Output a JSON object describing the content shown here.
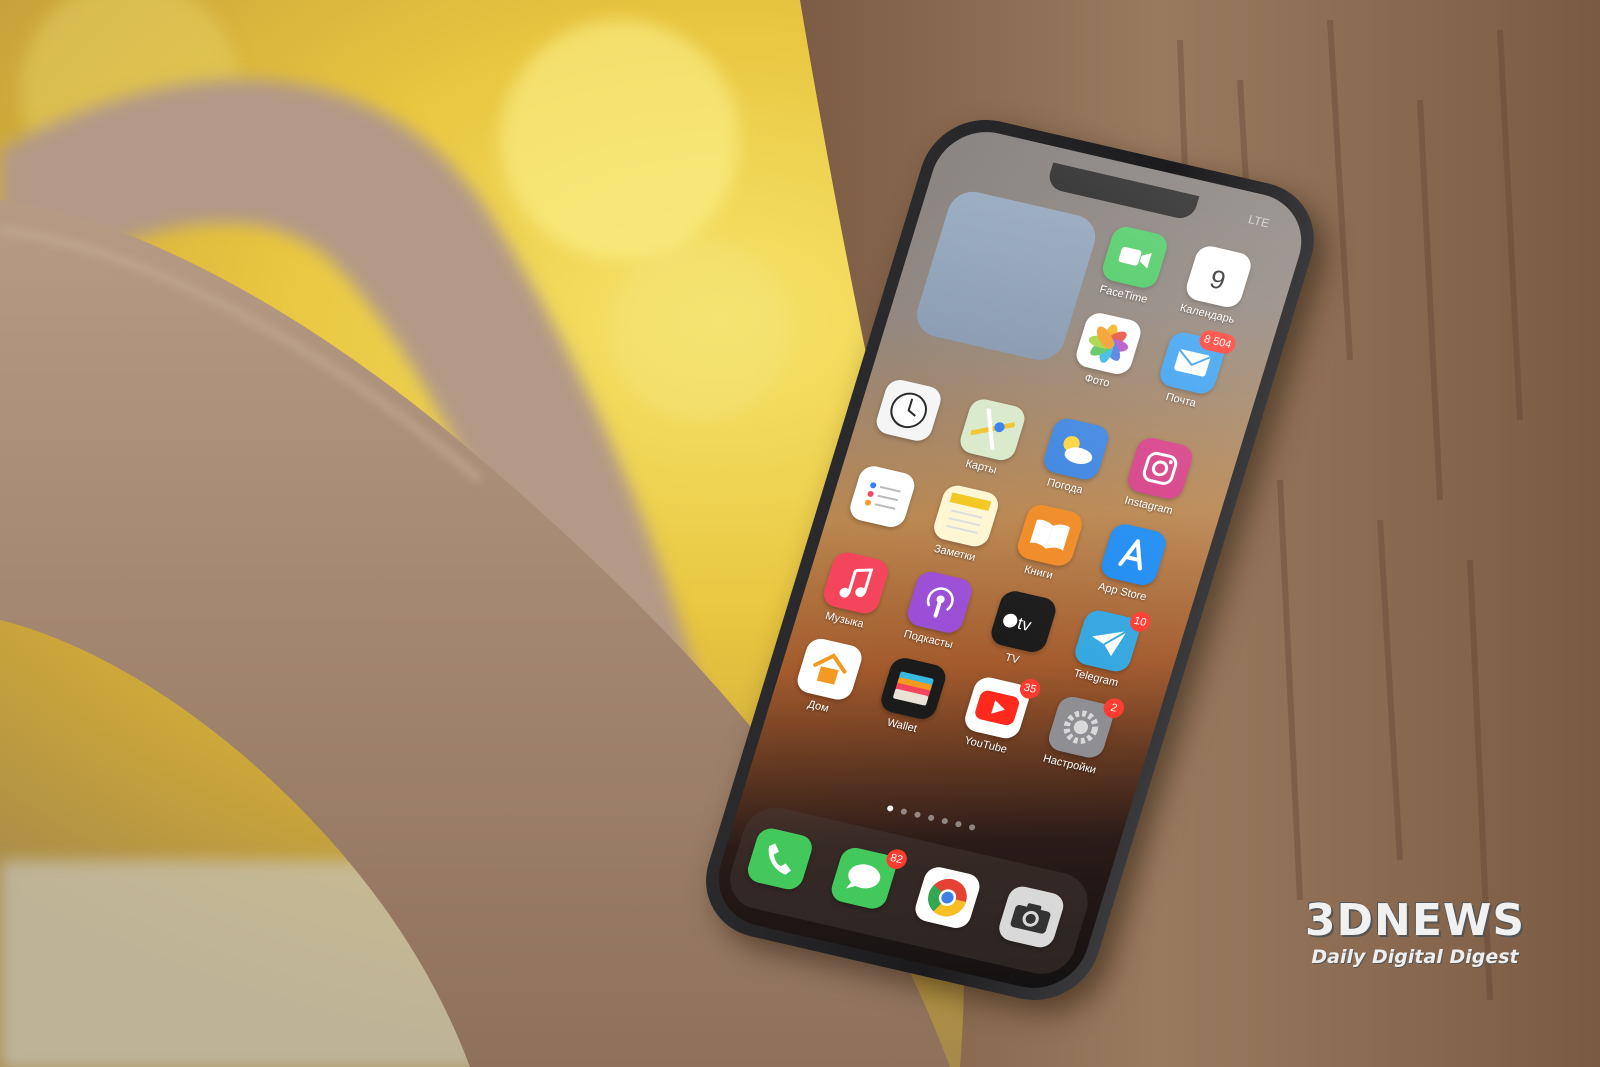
{
  "scene": {
    "description_colors": {
      "foliage": "#e7c94a",
      "bark": "#a0836a",
      "trunk": "#8d6b50",
      "phone_frame": "#1e1e20"
    }
  },
  "phone": {
    "status": {
      "time": "",
      "carrier": "LTE"
    },
    "widget": {
      "label": ""
    },
    "apps": [
      {
        "id": "facetime",
        "label": "FaceTime",
        "icon": "video-camera",
        "color": "#43c85c",
        "badge": ""
      },
      {
        "id": "calendar",
        "label": "Календарь",
        "icon": "calendar-day",
        "color": "#ffffff",
        "badge": "",
        "day": "9"
      },
      {
        "id": "photos",
        "label": "Фото",
        "icon": "photos-flower",
        "color": "#ffffff",
        "badge": ""
      },
      {
        "id": "mail",
        "label": "Почта",
        "icon": "envelope",
        "color": "#3aa0f0",
        "badge": "8 504"
      },
      {
        "id": "clock",
        "label": "",
        "icon": "clock",
        "color": "#f5f5f5",
        "badge": ""
      },
      {
        "id": "maps",
        "label": "Карты",
        "icon": "map",
        "color": "#d8e9c9",
        "badge": ""
      },
      {
        "id": "weather",
        "label": "Погода",
        "icon": "weather-cloud-sun",
        "color": "#3b84e0",
        "badge": ""
      },
      {
        "id": "instagram",
        "label": "Instagram",
        "icon": "instagram-camera",
        "color": "#d63e86",
        "badge": ""
      },
      {
        "id": "reminders",
        "label": "",
        "icon": "list",
        "color": "#ffffff",
        "badge": ""
      },
      {
        "id": "notes",
        "label": "Заметки",
        "icon": "notepad",
        "color": "#fff6d3",
        "badge": ""
      },
      {
        "id": "books",
        "label": "Книги",
        "icon": "open-book",
        "color": "#f08a24",
        "badge": ""
      },
      {
        "id": "appstore",
        "label": "App Store",
        "icon": "app-store-a",
        "color": "#1e8cf2",
        "badge": ""
      },
      {
        "id": "music",
        "label": "Музыка",
        "icon": "music-note",
        "color": "#f5455c",
        "badge": ""
      },
      {
        "id": "podcasts",
        "label": "Подкасты",
        "icon": "podcast",
        "color": "#9b4fd6",
        "badge": ""
      },
      {
        "id": "tv",
        "label": "TV",
        "icon": "apple-tv",
        "color": "#1a1a1a",
        "badge": ""
      },
      {
        "id": "telegram",
        "label": "Telegram",
        "icon": "paper-plane",
        "color": "#34a6e0",
        "badge": "10"
      },
      {
        "id": "home",
        "label": "Дом",
        "icon": "house",
        "color": "#ffffff",
        "badge": ""
      },
      {
        "id": "wallet",
        "label": "Wallet",
        "icon": "wallet-cards",
        "color": "#1b1b1b",
        "badge": ""
      },
      {
        "id": "youtube",
        "label": "YouTube",
        "icon": "play-triangle",
        "color": "#ffffff",
        "badge": "35"
      },
      {
        "id": "settings",
        "label": "Настройки",
        "icon": "gear",
        "color": "#8e8e93",
        "badge": "2"
      }
    ],
    "page_dots": {
      "count": 7,
      "active": 0
    },
    "dock": [
      {
        "id": "phone",
        "label": "",
        "icon": "phone-handset",
        "color": "#43c85c",
        "badge": ""
      },
      {
        "id": "messages",
        "label": "",
        "icon": "speech-bubble",
        "color": "#43c85c",
        "badge": "82"
      },
      {
        "id": "chrome",
        "label": "",
        "icon": "chrome",
        "color": "#ffffff",
        "badge": ""
      },
      {
        "id": "camera",
        "label": "",
        "icon": "camera",
        "color": "#d9d9d9",
        "badge": ""
      }
    ]
  },
  "watermark": {
    "logo": "3DNEWS",
    "tagline": "Daily Digital Digest"
  }
}
